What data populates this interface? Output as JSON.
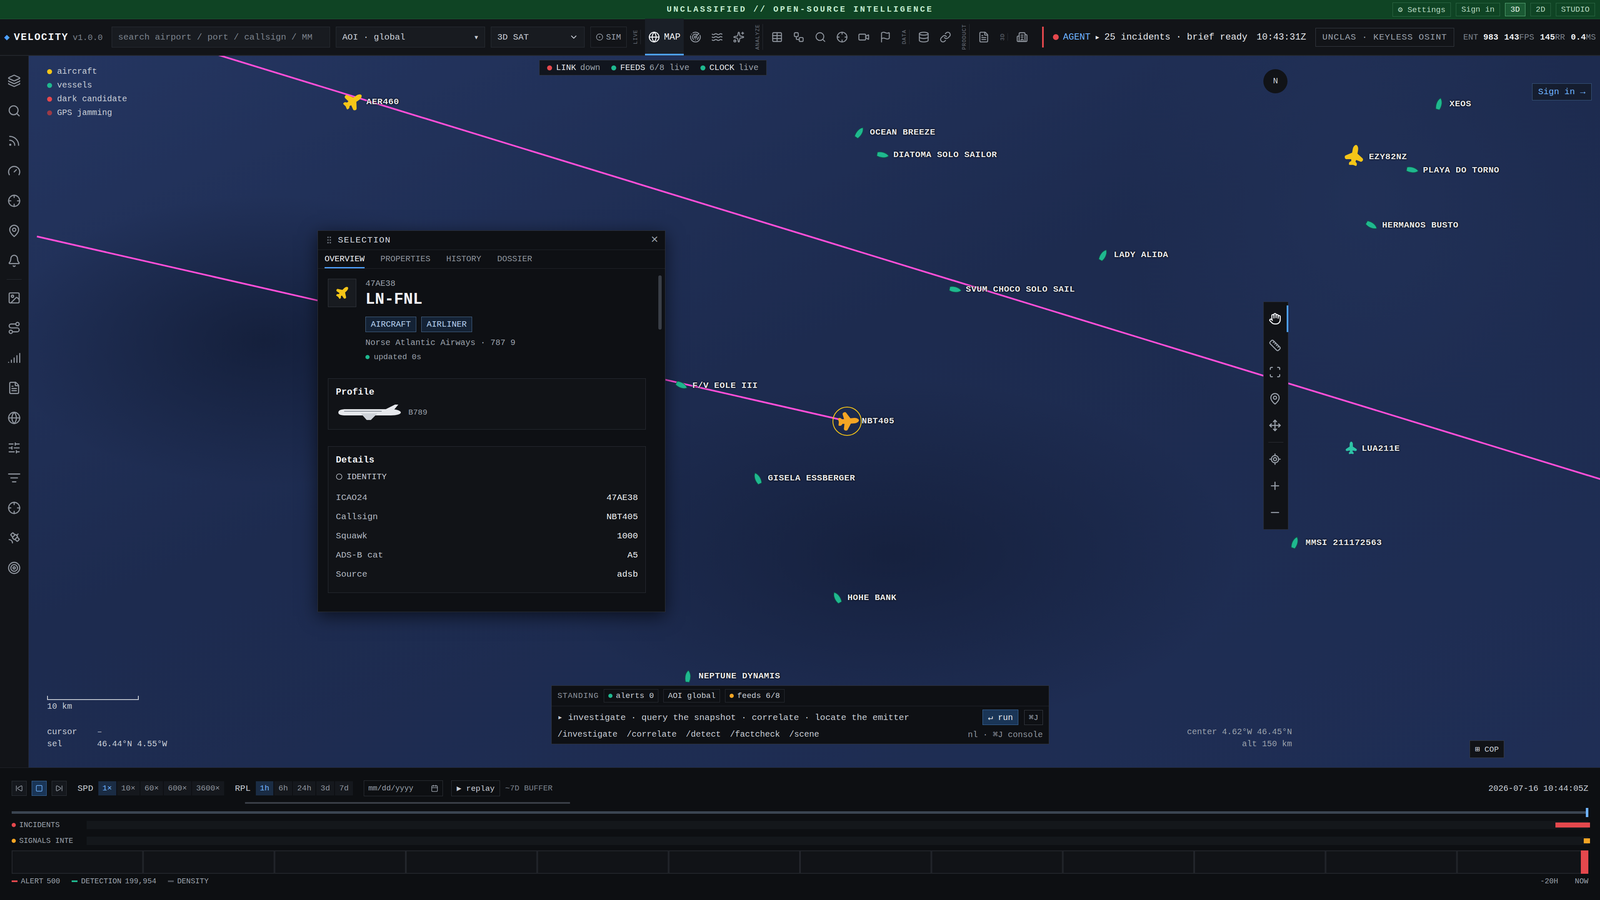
{
  "banner": {
    "text": "UNCLASSIFIED // OPEN-SOURCE INTELLIGENCE",
    "actions": [
      {
        "label": "⚙ Settings",
        "selected": false
      },
      {
        "label": "Sign in",
        "selected": false
      },
      {
        "label": "3D",
        "selected": true
      },
      {
        "label": "2D",
        "selected": false
      },
      {
        "label": "STUDIO",
        "selected": false
      }
    ]
  },
  "toolbar": {
    "logo_mark": "◆",
    "brand": "VELOCITY",
    "version": "v1.0.0",
    "search_placeholder": "search airport / port / callsign / MM",
    "aoi": "AOI · global",
    "aoi_caret": "▾",
    "basemap": "3D SAT",
    "sim": "SIM",
    "groups": [
      {
        "label": "LIVE",
        "buttons": [
          {
            "text": "MAP",
            "selected": true
          },
          {
            "selected": false
          },
          {
            "selected": false
          },
          {
            "selected": false
          }
        ]
      },
      {
        "label": "ANALYZE",
        "buttons": [
          {
            "selected": false
          },
          {
            "selected": false
          },
          {
            "selected": false
          },
          {
            "selected": false
          },
          {
            "selected": false
          },
          {
            "selected": false
          }
        ]
      },
      {
        "label": "DATA",
        "buttons": [
          {
            "selected": false
          },
          {
            "selected": false
          }
        ]
      },
      {
        "label": "PRODUCT",
        "buttons": [
          {
            "selected": false
          }
        ]
      },
      {
        "label": "3D",
        "buttons": [
          {
            "selected": false
          }
        ]
      }
    ],
    "agent": {
      "label": "AGENT",
      "arrow": "▸",
      "text": "25 incidents · brief ready",
      "color": "#e5484d"
    },
    "clock": "10:43:31Z",
    "classification": "UNCLAS · KEYLESS OSINT",
    "stats": [
      {
        "prefix": "ENT",
        "value": "983",
        "suffix": ""
      },
      {
        "prefix": "",
        "value": "143",
        "suffix": "FPS"
      },
      {
        "prefix": "",
        "value": "145",
        "suffix": "RR"
      },
      {
        "prefix": "",
        "value": "0.4",
        "suffix": "MS"
      }
    ]
  },
  "sidebar": {
    "items": [
      {
        "selected": false
      },
      {
        "selected": false
      },
      {
        "selected": false
      },
      {
        "selected": false
      },
      {
        "selected": false
      },
      {
        "selected": false
      },
      {
        "selected": false
      },
      {
        "selected": false
      },
      {
        "selected": false
      },
      {
        "selected": false
      },
      {
        "selected": false
      },
      {
        "selected": false
      },
      {
        "selected": false
      },
      {
        "selected": false
      },
      {
        "selected": false
      },
      {
        "selected": false
      },
      {
        "selected": false
      }
    ]
  },
  "map": {
    "legend": [
      {
        "label": "aircraft",
        "color": "#f5c518"
      },
      {
        "label": "vessels",
        "color": "#1fb88f"
      },
      {
        "label": "dark candidate",
        "color": "#e5484d"
      },
      {
        "label": "GPS jamming",
        "color": "#9b3a46"
      }
    ],
    "status": [
      {
        "label": "LINK",
        "value": "down",
        "color": "#e5484d"
      },
      {
        "label": "FEEDS",
        "value": "6/8 live",
        "color": "#1fb88f"
      },
      {
        "label": "CLOCK",
        "value": "live",
        "color": "#1fb88f"
      }
    ],
    "compass": "N",
    "sign_in": "Sign in →",
    "aircraft": [
      {
        "callsign": "AER460",
        "color": "#f5c518",
        "selected": false
      },
      {
        "callsign": "EZY82NZ",
        "color": "#f5c518",
        "selected": false
      },
      {
        "callsign": "NBT405",
        "color": "#f5a524",
        "selected": true
      },
      {
        "callsign": "LUA211E",
        "color": "#2ec4a6",
        "selected": false
      }
    ],
    "vessels": [
      {
        "name": "OCEAN BREEZE"
      },
      {
        "name": "DIATOMA SOLO SAILOR"
      },
      {
        "name": "LADY ALIDA"
      },
      {
        "name": "SVUM CHOCO SOLO SAIL"
      },
      {
        "name": "F/V EOLE III"
      },
      {
        "name": "GISELA ESSBERGER"
      },
      {
        "name": "HOHE BANK"
      },
      {
        "name": "NEPTUNE DYNAMIS"
      },
      {
        "name": "MMSI 211172563"
      },
      {
        "name": "XEOS"
      },
      {
        "name": "PLAYA DO TORNO"
      },
      {
        "name": "HERMANOS BUSTO"
      }
    ],
    "tools": [
      {
        "selected": true
      },
      {
        "selected": false
      },
      {
        "selected": false
      },
      {
        "selected": false
      },
      {
        "selected": false
      },
      {
        "selected": false
      },
      {
        "selected": false
      },
      {
        "selected": false
      }
    ],
    "scale": "10 km",
    "cursor": {
      "label": "cursor",
      "value": "–"
    },
    "sel": {
      "label": "sel",
      "value": "46.44°N 4.55°W"
    },
    "center": {
      "label": "center",
      "value": "4.62°W 46.45°N"
    },
    "alt": {
      "label": "alt",
      "value": "150 km"
    },
    "cop": "⊞ COP"
  },
  "selection": {
    "title": "SELECTION",
    "close": "×",
    "tabs": [
      {
        "label": "OVERVIEW",
        "selected": true
      },
      {
        "label": "PROPERTIES",
        "selected": false
      },
      {
        "label": "HISTORY",
        "selected": false
      },
      {
        "label": "DOSSIER",
        "selected": false
      }
    ],
    "icao": "47AE38",
    "registration": "LN-FNL",
    "chips": [
      "AIRCRAFT",
      "AIRLINER"
    ],
    "operator": "Norse Atlantic Airways · 787 9",
    "updated": "updated 0s",
    "profile": {
      "title": "Profile",
      "type": "B789"
    },
    "details": {
      "title": "Details",
      "section": "IDENTITY",
      "rows": [
        {
          "label": "ICAO24",
          "value": "47AE38"
        },
        {
          "label": "Callsign",
          "value": "NBT405"
        },
        {
          "label": "Squawk",
          "value": "1000"
        },
        {
          "label": "ADS-B cat",
          "value": "A5"
        },
        {
          "label": "Source",
          "value": "adsb"
        }
      ]
    }
  },
  "console": {
    "label": "STANDING",
    "chips": [
      {
        "label": "alerts 0",
        "color": "#1fb88f"
      },
      {
        "label": "AOI global"
      },
      {
        "label": "feeds 6/8",
        "color": "#f5a524"
      }
    ],
    "prompt_mark": "▸",
    "prompt": "investigate · query the snapshot · correlate · locate the emitter",
    "run": "↵ run",
    "shortcut": "⌘J",
    "commands": [
      "/investigate",
      "/correlate",
      "/detect",
      "/factcheck",
      "/scene"
    ],
    "hint": "nl · ⌘J console"
  },
  "timeline": {
    "transport": [
      {
        "selected": false
      },
      {
        "selected": true
      },
      {
        "selected": false
      }
    ],
    "speed_label": "SPD",
    "speeds": [
      {
        "label": "1×",
        "selected": true
      },
      {
        "label": "10×",
        "selected": false
      },
      {
        "label": "60×",
        "selected": false
      },
      {
        "label": "600×",
        "selected": false
      },
      {
        "label": "3600×",
        "selected": false
      }
    ],
    "replay_label": "RPL",
    "ranges": [
      {
        "label": "1h",
        "selected": true
      },
      {
        "label": "6h",
        "selected": false
      },
      {
        "label": "24h",
        "selected": false
      },
      {
        "label": "3d",
        "selected": false
      },
      {
        "label": "7d",
        "selected": false
      }
    ],
    "date_placeholder": "mm/dd/yyyy",
    "replay": "▶ replay",
    "buffer": "~7D BUFFER",
    "buffer_level": 1,
    "timestamp": "2026-07-16 10:44:05Z",
    "level": 1,
    "tracks": [
      {
        "label": "INCIDENTS",
        "color": "#e5484d",
        "start": 0.978,
        "end": 1
      },
      {
        "label": "SIGNALS INTE",
        "color": "#f5a524",
        "start": 0.997,
        "end": 1
      }
    ],
    "histogram": [
      0,
      0,
      0,
      0,
      0,
      0,
      0,
      0,
      0,
      0,
      0,
      0,
      0,
      0,
      0,
      0,
      0,
      0,
      0,
      0,
      0,
      0,
      0,
      0,
      0,
      0,
      0,
      0,
      0,
      0,
      0,
      0,
      0,
      0,
      0,
      0,
      0,
      0,
      0,
      0,
      0,
      0,
      0,
      0,
      0,
      0,
      0,
      500
    ],
    "footer": [
      {
        "label": "ALERT",
        "value": "500",
        "color": "#e5484d"
      },
      {
        "label": "DETECTION",
        "value": "199,954",
        "color": "#1fb88f"
      },
      {
        "label": "DENSITY",
        "color": "#4a4f57"
      }
    ],
    "ticks": [
      "-20H",
      "NOW"
    ]
  }
}
